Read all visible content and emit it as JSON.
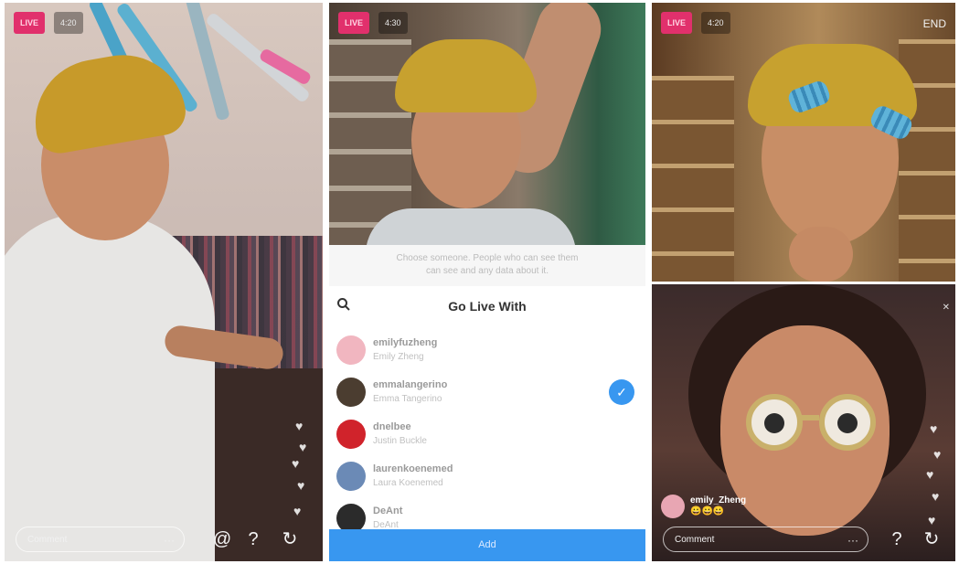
{
  "panel1": {
    "live_label": "LIVE",
    "viewers": "4:20",
    "comment_placeholder": "Comment",
    "icons": [
      "at-icon",
      "question-icon",
      "share-icon"
    ]
  },
  "panel2": {
    "notice_line1": "Choose someone. People who can see them",
    "notice_line2": "can see and any data about it.",
    "title": "Go Live With",
    "users": [
      {
        "username": "emilyfuzheng",
        "fullname": "Emily Zheng",
        "avatar_color": "#f1b6c0",
        "selected": false
      },
      {
        "username": "emmalangerino",
        "fullname": "Emma Tangerino",
        "avatar_color": "#4b3d30",
        "selected": true
      },
      {
        "username": "dnelbee",
        "fullname": "Justin Buckle",
        "avatar_color": "#d0232b",
        "selected": false
      },
      {
        "username": "laurenkoenemed",
        "fullname": "Laura Koenemed",
        "avatar_color": "#6b8ab6",
        "selected": false
      },
      {
        "username": "DeAnt",
        "fullname": "DeAnt",
        "avatar_color": "#2b2b2b",
        "selected": false
      }
    ],
    "add_button": "Add",
    "live_label": "LIVE",
    "viewers": "4:30"
  },
  "panel3": {
    "live_label": "LIVE",
    "viewers": "4:20",
    "close": "END",
    "comment_user": "emily_Zheng",
    "comment_text": "😀😀😀",
    "comment_placeholder": "Comment",
    "close_small": "✕"
  },
  "colors": {
    "live": "#e1306c",
    "accent_blue": "#3897f0"
  }
}
